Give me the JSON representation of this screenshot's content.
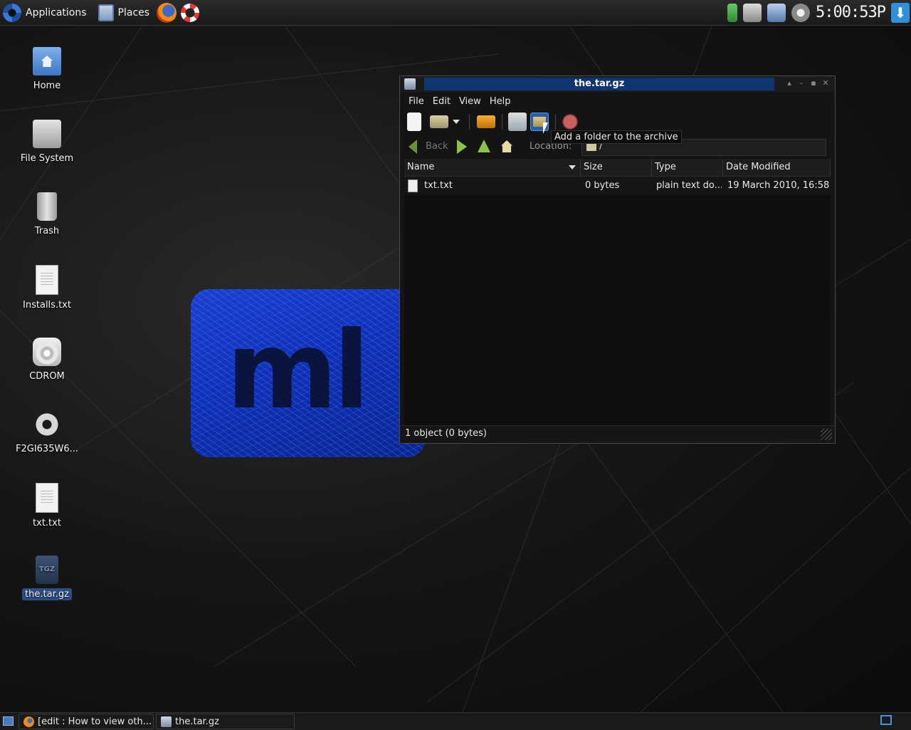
{
  "top_panel": {
    "applications_label": "Applications",
    "places_label": "Places",
    "clock": "5:00:53P"
  },
  "desktop_icons": [
    {
      "label": "Home",
      "icon": "home-folder-icon"
    },
    {
      "label": "File System",
      "icon": "hard-disk-icon"
    },
    {
      "label": "Trash",
      "icon": "trash-icon"
    },
    {
      "label": "Installs.txt",
      "icon": "text-file-icon"
    },
    {
      "label": "CDROM",
      "icon": "cdrom-icon"
    },
    {
      "label": "F2GI635W6...",
      "icon": "gear-file-icon"
    },
    {
      "label": "txt.txt",
      "icon": "text-file-icon"
    },
    {
      "label": "the.tar.gz",
      "icon": "tgz-archive-icon",
      "selected": true
    }
  ],
  "window": {
    "title": "the.tar.gz",
    "menu": [
      "File",
      "Edit",
      "View",
      "Help"
    ],
    "tooltip": "Add a folder to the archive",
    "nav": {
      "back_label": "Back",
      "location_label": "Location:",
      "location_value": "/"
    },
    "columns": [
      "Name",
      "Size",
      "Type",
      "Date Modified"
    ],
    "rows": [
      {
        "name": "txt.txt",
        "size": "0 bytes",
        "type": "plain text do...",
        "modified": "19 March 2010, 16:58"
      }
    ],
    "status": "1 object (0 bytes)"
  },
  "taskbar": {
    "tasks": [
      {
        "label": "[edit : How to view oth...",
        "icon": "firefox-icon"
      },
      {
        "label": "the.tar.gz",
        "icon": "archive-manager-icon"
      }
    ]
  },
  "colors": {
    "title_active": "#0f3670",
    "selection": "#2a5da8",
    "desktop_logo": "#1b3fd0"
  }
}
